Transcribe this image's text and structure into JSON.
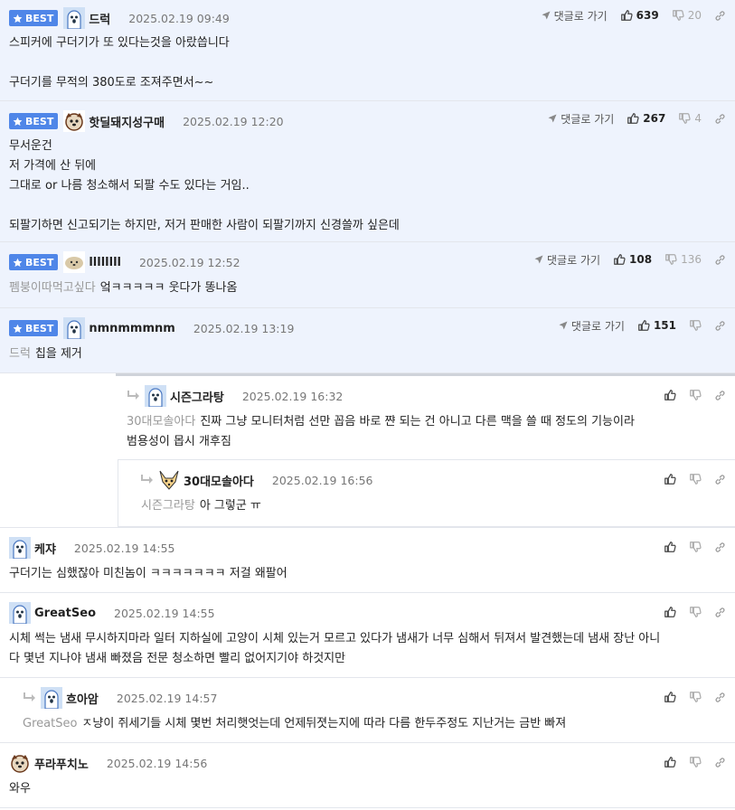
{
  "best_label": "BEST",
  "reply_label": "댓글로 가기",
  "comments": [
    {
      "nick": "드럭",
      "date": "2025.02.19 09:49",
      "up": "639",
      "down": "20",
      "line1": "스피커에 구더기가 또 있다는것을 아랐씁니다",
      "line2": "",
      "line3": "구더기를 무적의 380도로 조져주면서~~"
    },
    {
      "nick": "핫딜돼지성구매",
      "date": "2025.02.19 12:20",
      "up": "267",
      "down": "4",
      "line1": "무서운건",
      "line2": "저 가격에 산 뒤에",
      "line3": "그대로 or 나름 청소해서 되팔 수도 있다는 거임..",
      "line4": "",
      "line5": "되팔기하면 신고되기는 하지만, 저거 판매한 사람이 되팔기까지 신경쓸까 싶은데"
    },
    {
      "nick": "llllllll",
      "date": "2025.02.19 12:52",
      "up": "108",
      "down": "136",
      "mention": "펨붕이따먹고싶다",
      "text": "엌ㅋㅋㅋㅋㅋ 웃다가 똥나옴"
    },
    {
      "nick": "nmnmmmnm",
      "date": "2025.02.19 13:19",
      "up": "151",
      "down": "",
      "mention": "드럭",
      "text": "칩을 제거"
    },
    {
      "nick": "시즌그라탕",
      "date": "2025.02.19 16:32",
      "mention": "30대모솔아다",
      "text": "진짜 그냥 모니터처럼 선만 꼽음 바로 쨘 되는 건 아니고 다른 맥을 쓸 때 정도의 기능이라",
      "text2": "범용성이 몹시 개후짐"
    },
    {
      "nick": "30대모솔아다",
      "date": "2025.02.19 16:56",
      "mention": "시즌그라탕",
      "text": "아 그렇군 ㅠ"
    },
    {
      "nick": "케쟈",
      "date": "2025.02.19 14:55",
      "text": "구더기는 심했잖아 미친놈이 ㅋㅋㅋㅋㅋㅋㅋ 저걸 왜팔어"
    },
    {
      "nick": "GreatSeo",
      "date": "2025.02.19 14:55",
      "text": "시체 썩는 냄새 무시하지마라 일터 지하실에 고양이 시체 있는거 모르고 있다가 냄새가 너무 심해서 뒤져서 발견했는데 냄새 장난 아니",
      "text2": "다 몇년 지나야 냄새 빠졌음 전문 청소하면 빨리 없어지기야 하것지만"
    },
    {
      "nick": "흐아암",
      "date": "2025.02.19 14:57",
      "mention": "GreatSeo",
      "text": "ㅈ냥이 쥐세기들 시체 몇번 처리햇엇는데 언제뒤졋는지에 따라 다름 한두주정도 지난거는 금반 빠져"
    },
    {
      "nick": "푸라푸치노",
      "date": "2025.02.19 14:56",
      "text": "와우"
    }
  ]
}
